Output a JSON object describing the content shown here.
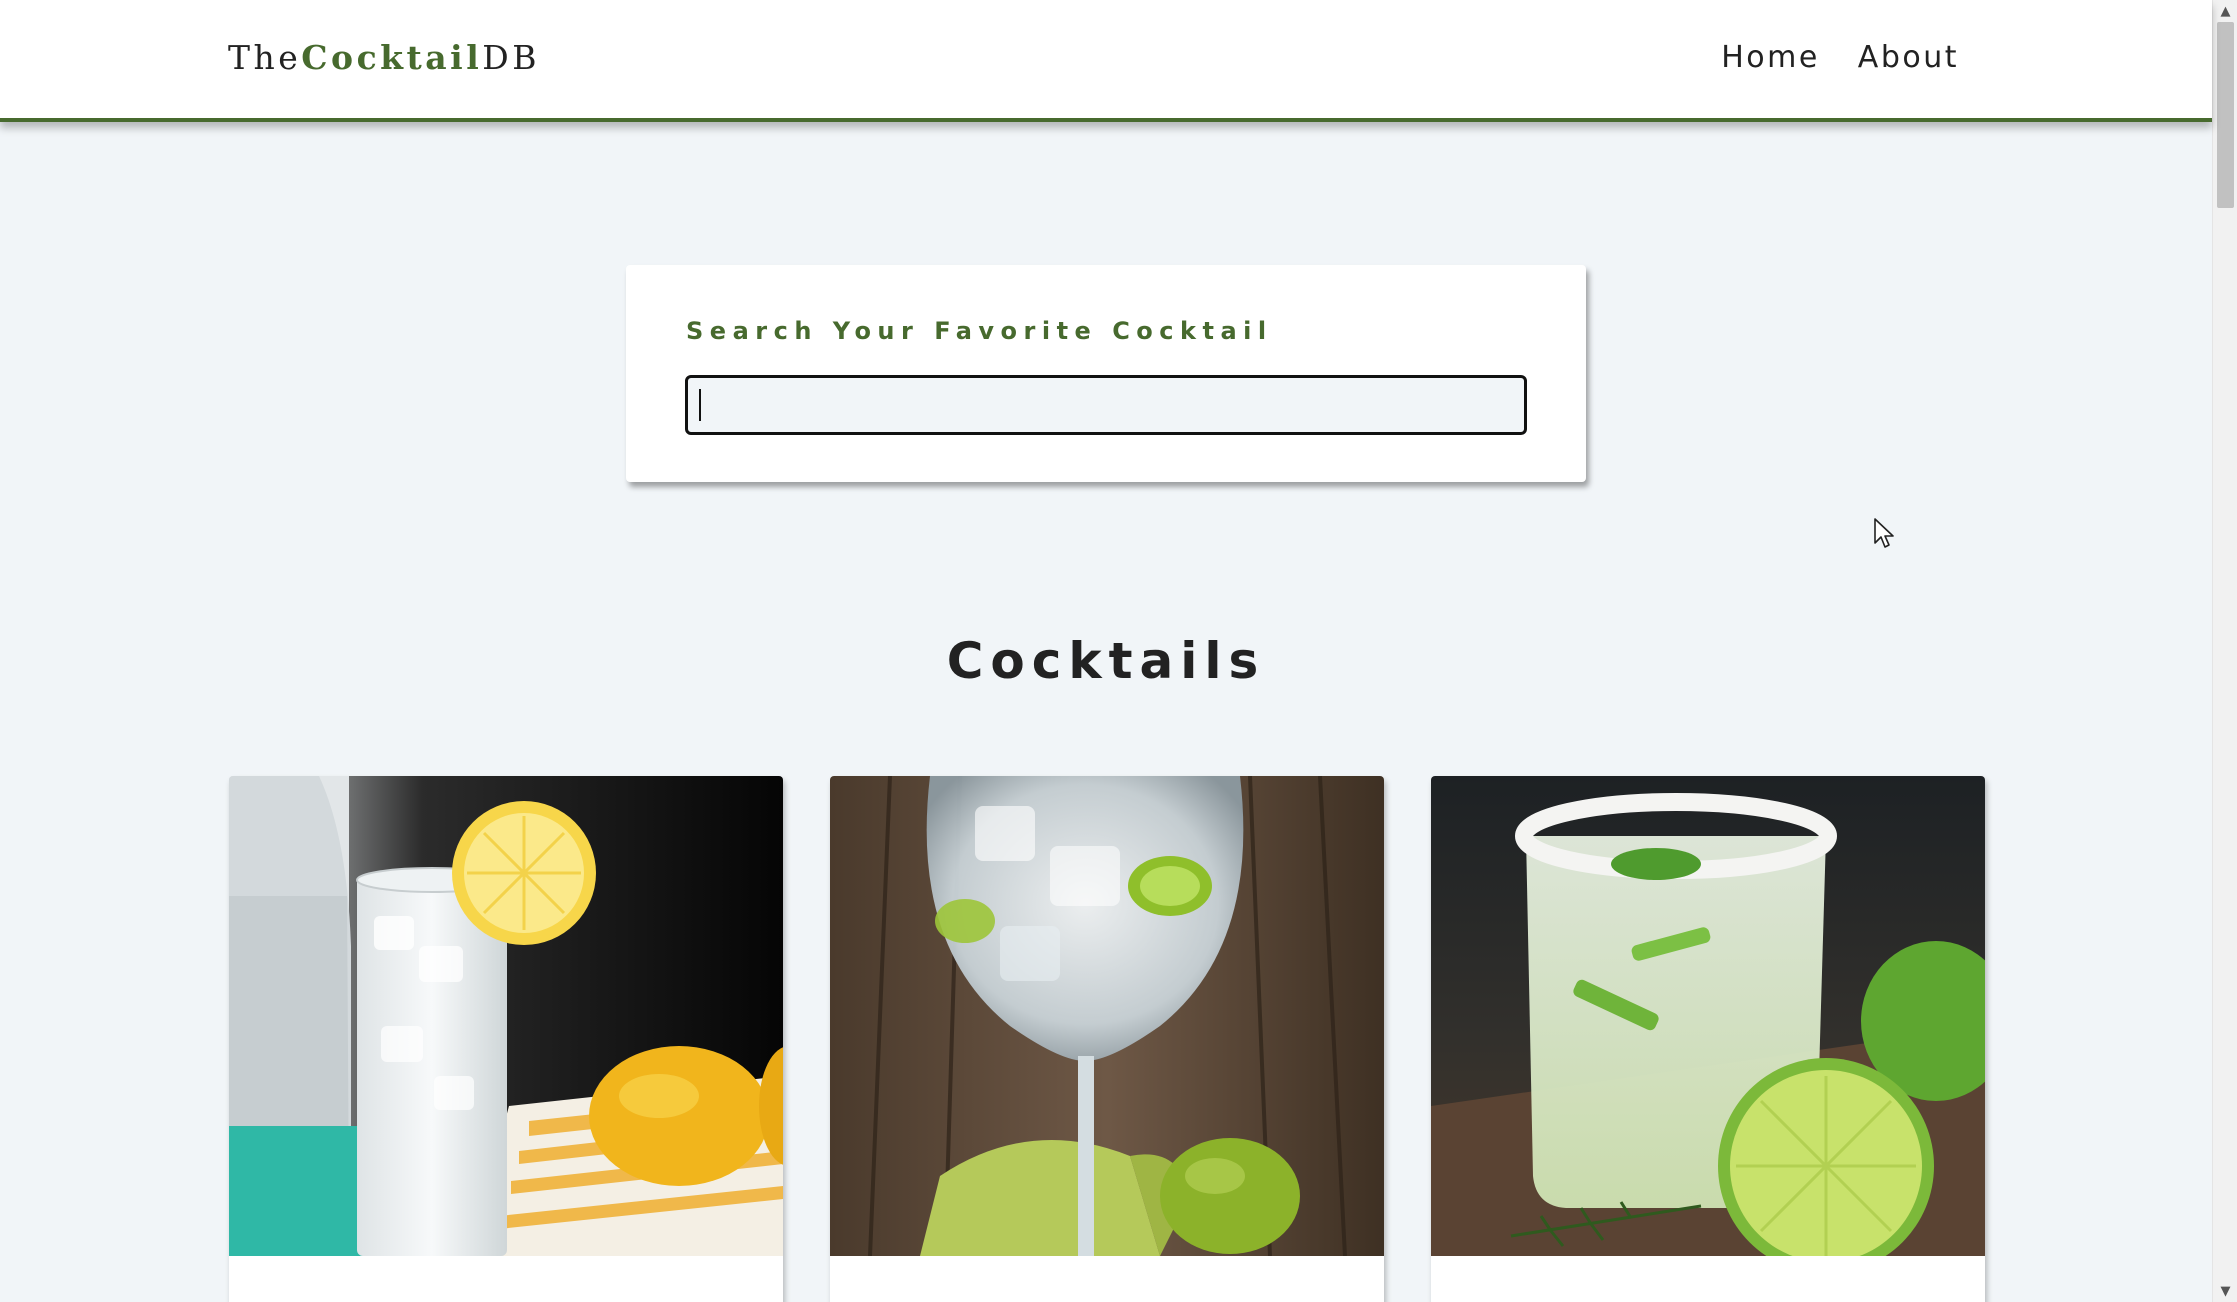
{
  "navbar": {
    "logo": {
      "prefix": "The",
      "accent": "Cocktail",
      "suffix": "DB"
    },
    "links": [
      {
        "label": "Home"
      },
      {
        "label": "About"
      }
    ]
  },
  "search": {
    "label": "Search Your Favorite Cocktail",
    "value": "",
    "placeholder": ""
  },
  "section": {
    "title": "Cocktails"
  },
  "colors": {
    "accent": "#476a2e",
    "background": "#f1f5f8",
    "card": "#ffffff"
  },
  "cocktails": [
    {
      "image_subject": "lemonade glass with lemon slice"
    },
    {
      "image_subject": "gin and tonic with lime"
    },
    {
      "image_subject": "margarita with salt rim and lime"
    }
  ]
}
